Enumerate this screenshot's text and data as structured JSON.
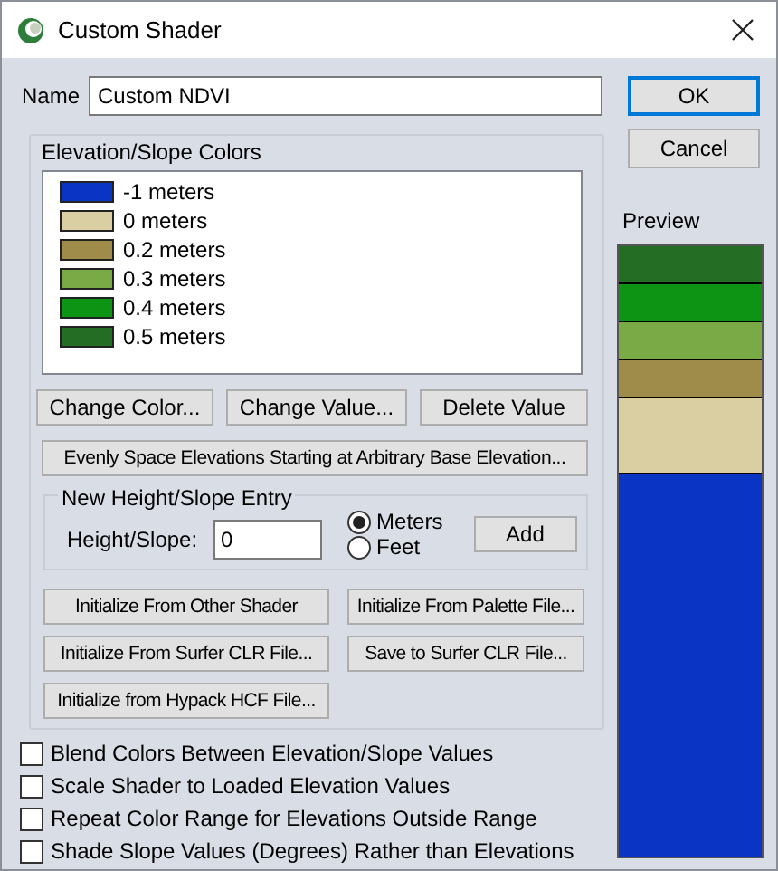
{
  "window": {
    "title": "Custom Shader"
  },
  "name_field": {
    "label": "Name",
    "value": "Custom NDVI"
  },
  "buttons": [
    "OK",
    "Cancel"
  ],
  "colors_group": {
    "title": "Elevation/Slope Colors",
    "items": [
      {
        "label": "-1 meters",
        "color": "#0a34c4"
      },
      {
        "label": "0 meters",
        "color": "#d9cfa2"
      },
      {
        "label": "0.2 meters",
        "color": "#a08c4a"
      },
      {
        "label": "0.3 meters",
        "color": "#79aa46"
      },
      {
        "label": "0.4 meters",
        "color": "#0e9415"
      },
      {
        "label": "0.5 meters",
        "color": "#246d24"
      }
    ]
  },
  "edit_buttons": [
    "Change Color...",
    "Change Value...",
    "Delete Value"
  ],
  "evenly_button": "Evenly Space Elevations Starting at Arbitrary Base Elevation...",
  "entry_group": {
    "title": "New Height/Slope Entry",
    "field_label": "Height/Slope:",
    "value": "0",
    "units": [
      {
        "label": "Meters",
        "selected": true
      },
      {
        "label": "Feet",
        "selected": false
      }
    ],
    "add_button": "Add"
  },
  "file_buttons": [
    "Initialize From Other Shader",
    "Initialize From Palette File...",
    "Initialize From Surfer CLR File...",
    "Save to Surfer CLR File...",
    "Initialize from Hypack HCF File..."
  ],
  "options": [
    {
      "label": "Blend Colors Between Elevation/Slope Values",
      "checked": false
    },
    {
      "label": "Scale Shader to Loaded Elevation Values",
      "checked": false
    },
    {
      "label": "Repeat Color Range for Elevations Outside Range",
      "checked": false
    },
    {
      "label": "Shade Slope Values (Degrees) Rather than Elevations",
      "checked": false
    }
  ],
  "preview": {
    "title": "Preview"
  }
}
